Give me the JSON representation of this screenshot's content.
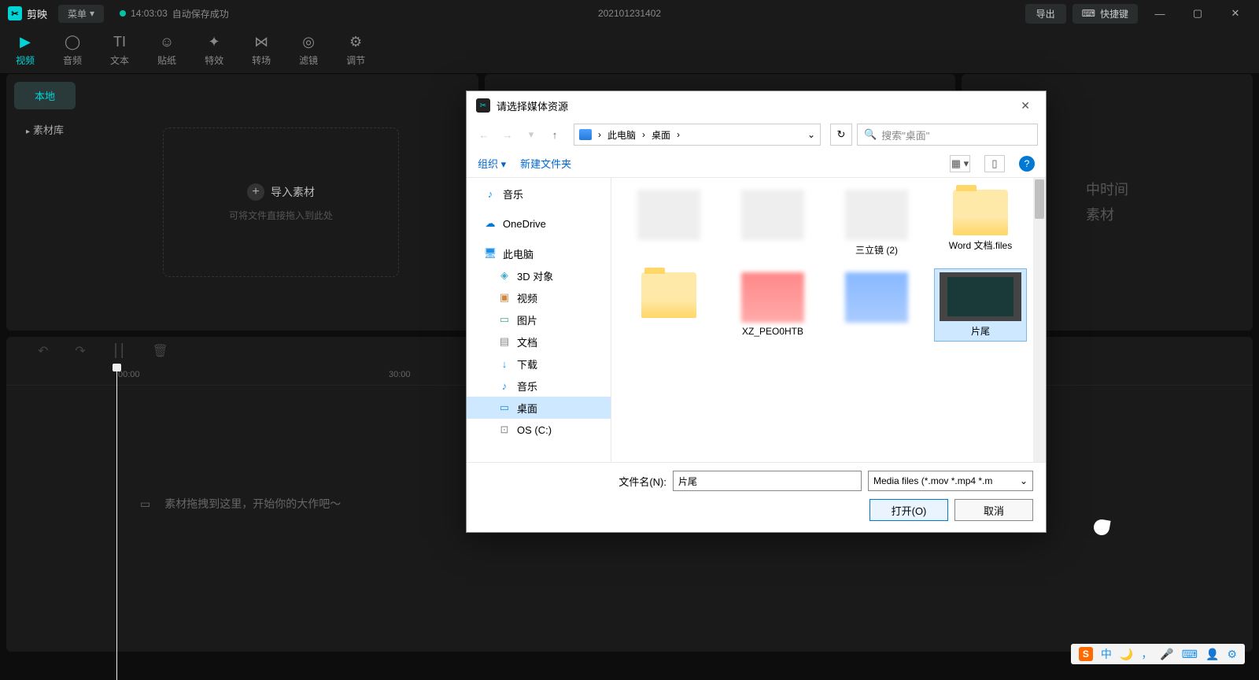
{
  "titlebar": {
    "app_name": "剪映",
    "menu_label": "菜单",
    "autosave_time": "14:03:03",
    "autosave_text": "自动保存成功",
    "project_name": "202101231402",
    "export_label": "导出",
    "shortcut_label": "快捷键"
  },
  "tabs": {
    "video": "视频",
    "audio": "音频",
    "text": "文本",
    "sticker": "贴纸",
    "effect": "特效",
    "transition": "转场",
    "filter": "滤镜",
    "adjust": "调节"
  },
  "sidebar": {
    "local": "本地",
    "library": "素材库"
  },
  "import": {
    "title": "导入素材",
    "subtitle": "可将文件直接拖入到此处"
  },
  "right_panel": {
    "line1": "中时间",
    "line2": "素材"
  },
  "timeline": {
    "tick0": "00:00",
    "tick1": "30:00",
    "hint": "素材拖拽到这里，开始你的大作吧～"
  },
  "dialog": {
    "title": "请选择媒体资源",
    "path_pc": "此电脑",
    "path_desktop": "桌面",
    "search_placeholder": "搜索\"桌面\"",
    "organize": "组织",
    "new_folder": "新建文件夹",
    "tree": {
      "music_q": "音乐",
      "onedrive": "OneDrive",
      "this_pc": "此电脑",
      "objects3d": "3D 对象",
      "videos": "视频",
      "pictures": "图片",
      "documents": "文档",
      "downloads": "下载",
      "music": "音乐",
      "desktop": "桌面",
      "osc": "OS (C:)"
    },
    "files": {
      "blur_top_right": "三立镜 (2)",
      "word_files": "Word 文档.files",
      "xz": "XZ_PEO0HTB",
      "pianwei": "片尾"
    },
    "filename_label": "文件名(N):",
    "filename_value": "片尾",
    "filter_label": "Media files (*.mov *.mp4 *.m",
    "open_btn": "打开(O)",
    "cancel_btn": "取消"
  },
  "ime": {
    "cn": "中"
  }
}
